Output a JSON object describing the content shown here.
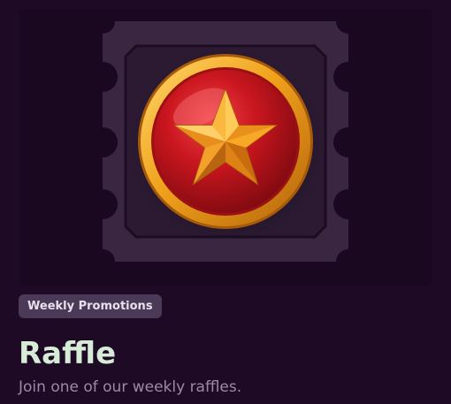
{
  "promotion": {
    "badge_label": "Weekly Promotions",
    "title": "Raffle",
    "description": "Join one of our weekly raffles."
  },
  "image": {
    "icon": "raffle-ticket-star-medal",
    "colors": {
      "page_background": "#1f0a26",
      "ticket": "#3a2640",
      "medal_red": "#c9161e",
      "medal_gold": "#f0a21c",
      "badge_background": "#4b3a57",
      "title_color": "#d6ecd6"
    }
  }
}
